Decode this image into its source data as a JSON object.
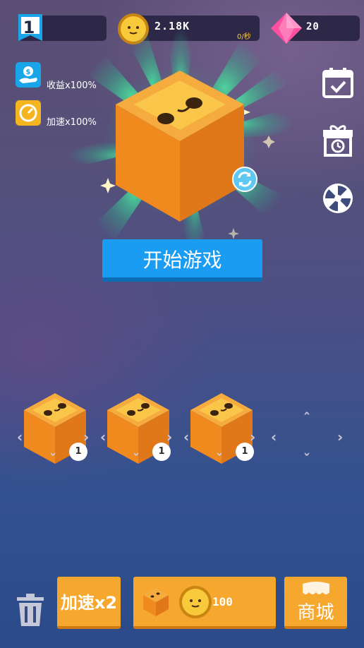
{
  "top_bar": {
    "level": "1",
    "coins": "2.18K",
    "coin_rate": "0/秒",
    "gems": "20"
  },
  "buffs": [
    {
      "label": "收益x100%",
      "icon": "income-icon",
      "color": "#1aa5e8"
    },
    {
      "label": "加速x100%",
      "icon": "speedometer-icon",
      "color": "#f4b520"
    }
  ],
  "side_menu": [
    {
      "icon": "calendar-check-icon"
    },
    {
      "icon": "gift-clock-icon"
    },
    {
      "icon": "lucky-wheel-icon"
    }
  ],
  "start_button": {
    "label": "开始游戏"
  },
  "slots": [
    {
      "level": "1",
      "filled": true
    },
    {
      "level": "1",
      "filled": true
    },
    {
      "level": "1",
      "filled": true
    },
    {
      "level": "",
      "filled": false
    }
  ],
  "bottom_bar": {
    "speed_label": "加速x2",
    "buy_price": "100",
    "shop_label": "商城"
  },
  "colors": {
    "accent_blue": "#1a9cf2",
    "orange": "#f6a72e",
    "cube": "#f2a23a",
    "panel": "#2d2848",
    "gem": "#ff4fa0"
  }
}
